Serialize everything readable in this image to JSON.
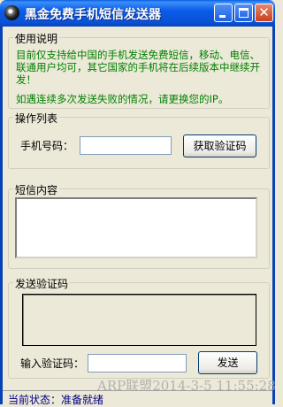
{
  "window": {
    "title": "黑金免费手机短信发送器",
    "icons": {
      "app": "disc-icon",
      "minimize": "minimize-icon",
      "maximize": "maximize-icon",
      "close": "close-icon"
    },
    "close_glyph": "✕"
  },
  "usage": {
    "legend": "使用说明",
    "text1": "目前仅支持给中国的手机发送免费短信，移动、电信、联通用户均可，其它国家的手机将在后续版本中继续开发！",
    "text2": "如遇连续多次发送失败的情况，请更换您的IP。"
  },
  "operations": {
    "legend": "操作列表",
    "phone_label": "手机号码：",
    "phone_value": "",
    "get_code_button": "获取验证码"
  },
  "sms": {
    "legend": "短信内容",
    "content": ""
  },
  "verify": {
    "legend": "发送验证码",
    "input_label": "输入验证码：",
    "code_value": "",
    "send_button": "发送"
  },
  "status": {
    "text": "当前状态：准备就绪"
  },
  "watermark": "ARP联盟2014-3-5 11:55:28",
  "colors": {
    "titlebar": "#0a51d6",
    "info_text": "#008000",
    "status_text": "#000080",
    "window_bg": "#ece9d8"
  }
}
